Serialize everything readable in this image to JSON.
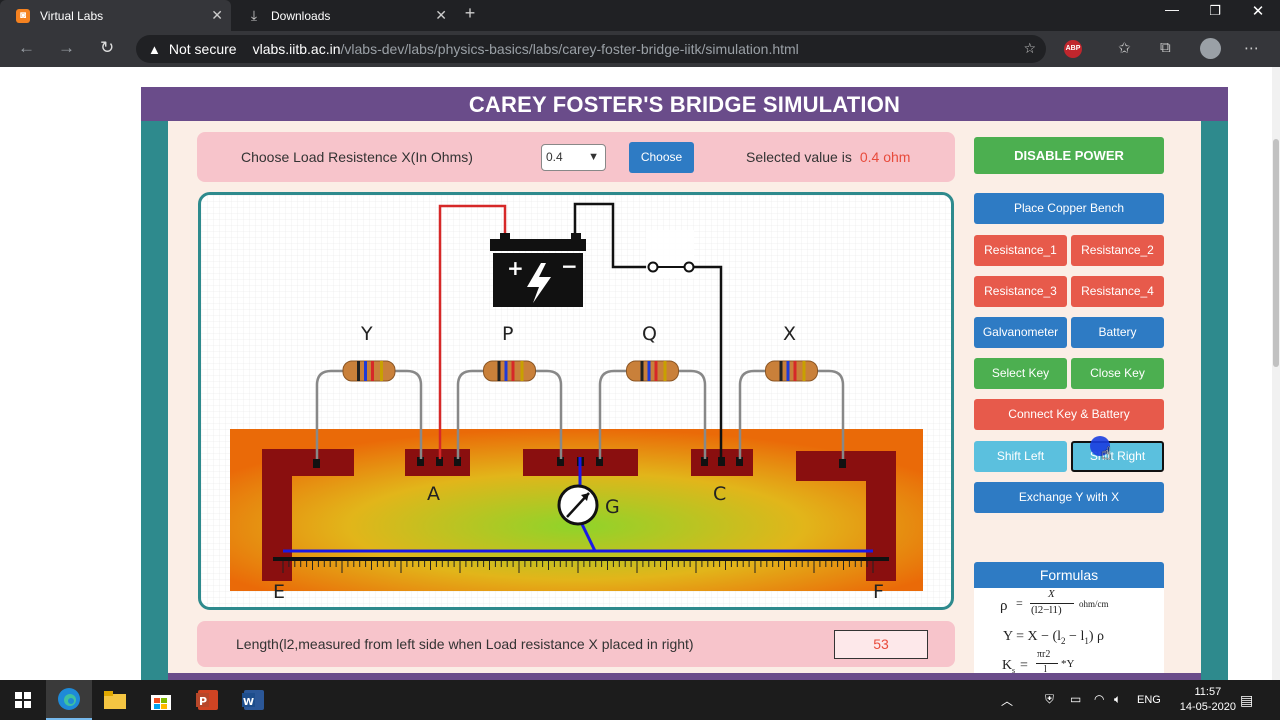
{
  "browser": {
    "tabs": [
      {
        "title": "Virtual Labs",
        "active": true
      },
      {
        "title": "Downloads",
        "active": false
      }
    ],
    "security_label": "Not secure",
    "url_host": "vlabs.iitb.ac.in",
    "url_path": "/vlabs-dev/labs/physics-basics/labs/carey-foster-bridge-iitk/simulation.html",
    "ext_badge": "ABP"
  },
  "page": {
    "title": "CAREY FOSTER'S BRIDGE SIMULATION",
    "load_label": "Choose Load Resistence X(In Ohms)",
    "load_value": "0.4",
    "choose_label": "Choose",
    "selected_label": "Selected value is",
    "selected_value": "0.4 ohm",
    "length_label": "Length(l2,measured from left side when Load resistance X placed in right)",
    "length_value": "53"
  },
  "diagram": {
    "resistor_labels": [
      "Y",
      "P",
      "Q",
      "X"
    ],
    "junction_A": "A",
    "junction_C": "C",
    "galvanometer": "G",
    "end_E": "E",
    "end_F": "F"
  },
  "controls": {
    "disable_power": "DISABLE POWER",
    "place_bench": "Place Copper Bench",
    "res1": "Resistance_1",
    "res2": "Resistance_2",
    "res3": "Resistance_3",
    "res4": "Resistance_4",
    "galvanometer": "Galvanometer",
    "battery": "Battery",
    "select_key": "Select Key",
    "close_key": "Close Key",
    "connect": "Connect Key & Battery",
    "shift_left": "Shift Left",
    "shift_right": "Shift Right",
    "exchange": "Exchange Y with X"
  },
  "formulas": {
    "title": "Formulas",
    "rho_sym": "ρ",
    "rho_eq": "=",
    "rho_num": "X",
    "rho_den": "(l2−l1)",
    "rho_unit": "ohm/cm",
    "y_formula": "Y = X − (l",
    "y_sub2": "2",
    "y_mid": " − l",
    "y_sub1": "1",
    "y_end": ") ρ",
    "ks_sym": "K",
    "ks_sub": "s",
    "ks_eq": "=",
    "ks_num": "πr2",
    "ks_den": "l",
    "ks_tail": "*Y"
  },
  "taskbar": {
    "lang": "ENG",
    "time": "11:57",
    "date": "14-05-2020"
  },
  "colors": {
    "frame": "#2e8a8d",
    "titlebar": "#6a4c8a",
    "accent_red": "#e84b3c"
  }
}
